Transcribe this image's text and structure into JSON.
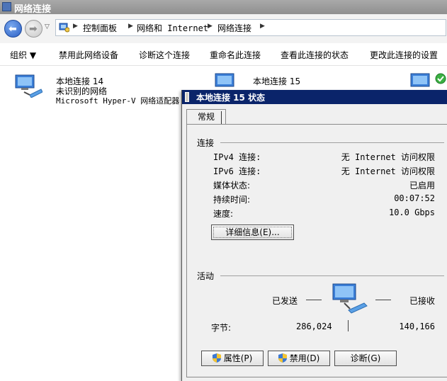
{
  "window": {
    "title": "网络连接"
  },
  "address": {
    "crumbs": [
      "控制面板",
      "网络和 Internet",
      "网络连接"
    ]
  },
  "toolbar": {
    "organize": "组织 ▼",
    "disable_device": "禁用此网络设备",
    "diagnose": "诊断这个连接",
    "rename": "重命名此连接",
    "view_status": "查看此连接的状态",
    "change_settings": "更改此连接的设置"
  },
  "connections": [
    {
      "name": "本地连接 14",
      "status": "未识别的网络",
      "adapter": "Microsoft Hyper-V 网络适配器"
    },
    {
      "name": "本地连接 15"
    }
  ],
  "dialog": {
    "title": "本地连接 15 状态",
    "tab": "常规",
    "connection_group": "连接",
    "rows": [
      {
        "label": "IPv4 连接:",
        "value": "无 Internet 访问权限"
      },
      {
        "label": "IPv6 连接:",
        "value": "无 Internet 访问权限"
      },
      {
        "label": "媒体状态:",
        "value": "已启用"
      },
      {
        "label": "持续时间:",
        "value": "00:07:52"
      },
      {
        "label": "速度:",
        "value": "10.0 Gbps"
      }
    ],
    "details_button": "详细信息(E)...",
    "activity_group": "活动",
    "sent_label": "已发送",
    "received_label": "已接收",
    "bytes_label": "字节:",
    "bytes_sent": "286,024",
    "bytes_received": "140,166",
    "properties_button": "属性(P)",
    "disable_button": "禁用(D)",
    "diagnose_button": "诊断(G)"
  },
  "colors": {
    "dialog_title_bg": "#0a246a",
    "window_title_bg": "#9b9b9b",
    "status_ok_green": "#3cb043"
  }
}
